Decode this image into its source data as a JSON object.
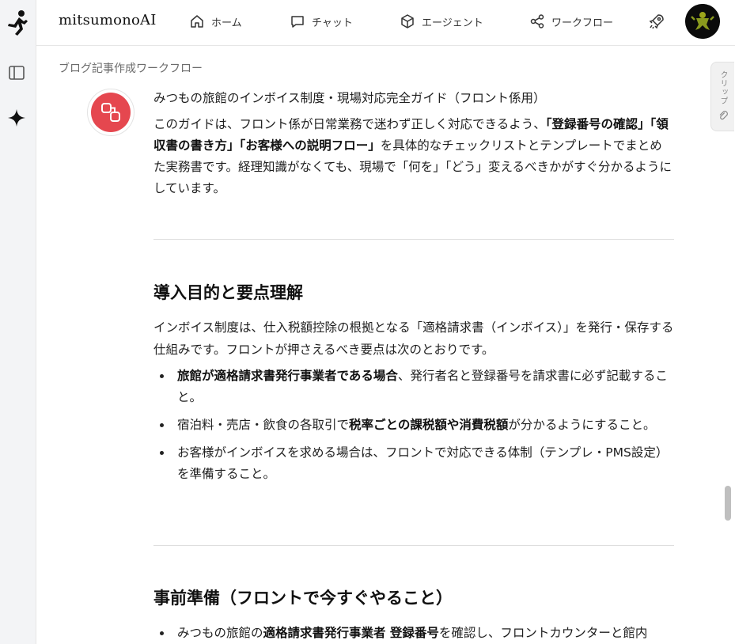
{
  "brand": "mitsumonoAI",
  "nav": {
    "home": "ホーム",
    "chat": "チャット",
    "agent": "エージェント",
    "workflow": "ワークフロー"
  },
  "breadcrumb": "ブログ記事作成ワークフロー",
  "clip_label": "クリップ",
  "colors": {
    "bot_accent": "#e5474f",
    "text": "#1f1f1f"
  },
  "message": {
    "title": "みつもの旅館のインボイス制度・現場対応完全ガイド（フロント係用）",
    "intro": {
      "t1": "このガイドは、フロント係が日常業務で迷わず正しく対応できるよう、",
      "b1": "「登録番号の確認」「領収書の書き方」「お客様への説明フロー」",
      "t2": "を具体的なチェックリストとテンプレートでまとめた実務書です。経理知識がなくても、現場で「何を」「どう」変えるべきかがすぐ分かるようにしています。"
    },
    "section1": {
      "heading": "導入目的と要点理解",
      "para": "インボイス制度は、仕入税額控除の根拠となる「適格請求書（インボイス）」を発行・保存する仕組みです。フロントが押さえるべき要点は次のとおりです。",
      "items": [
        {
          "b": "旅館が適格請求書発行事業者である場合",
          "t": "、発行者名と登録番号を請求書に必ず記載すること。"
        },
        {
          "t0": "宿泊料・売店・飲食の各取引で",
          "b": "税率ごとの課税額や消費税額",
          "t": "が分かるようにすること。"
        },
        {
          "t": "お客様がインボイスを求める場合は、フロントで対応できる体制（テンプレ・PMS設定）を準備すること。"
        }
      ]
    },
    "section2": {
      "heading": "事前準備（フロントで今すぐやること）",
      "items": [
        {
          "t0": "みつもの旅館の",
          "b": "適格請求書発行事業者 登録番号",
          "t": "を確認し、フロントカウンターと館内"
        }
      ]
    }
  }
}
